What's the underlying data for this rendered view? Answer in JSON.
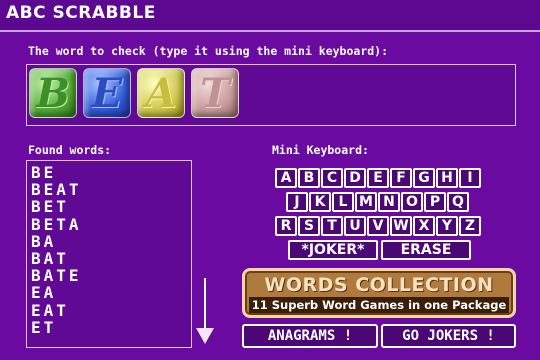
{
  "app": {
    "title": "ABC SCRABBLE"
  },
  "word_check": {
    "label": "The word to check (type it using the mini keyboard):",
    "tiles": [
      {
        "letter": "B",
        "color": "green"
      },
      {
        "letter": "E",
        "color": "blue"
      },
      {
        "letter": "A",
        "color": "yellow"
      },
      {
        "letter": "T",
        "color": "pink"
      }
    ]
  },
  "found_words": {
    "label": "Found words:",
    "words": [
      "BE",
      "BEAT",
      "BET",
      "BETA",
      "BA",
      "BAT",
      "BATE",
      "EA",
      "EAT",
      "ET"
    ]
  },
  "keyboard": {
    "label": "Mini Keyboard:",
    "rows": [
      [
        "A",
        "B",
        "C",
        "D",
        "E",
        "F",
        "G",
        "H",
        "I"
      ],
      [
        "J",
        "K",
        "L",
        "M",
        "N",
        "O",
        "P",
        "Q"
      ],
      [
        "R",
        "S",
        "T",
        "U",
        "V",
        "W",
        "X",
        "Y",
        "Z"
      ]
    ],
    "joker_label": "*JOKER*",
    "erase_label": "ERASE"
  },
  "promo": {
    "title": "WORDS COLLECTION",
    "subtitle": "11 Superb Word Games in one Package"
  },
  "buttons": {
    "anagrams": "ANAGRAMS !",
    "go_jokers": "GO JOKERS !"
  },
  "colors": {
    "background": "#6a0aa0",
    "key_fill": "#4b0875",
    "banner": "#b07a3e"
  }
}
